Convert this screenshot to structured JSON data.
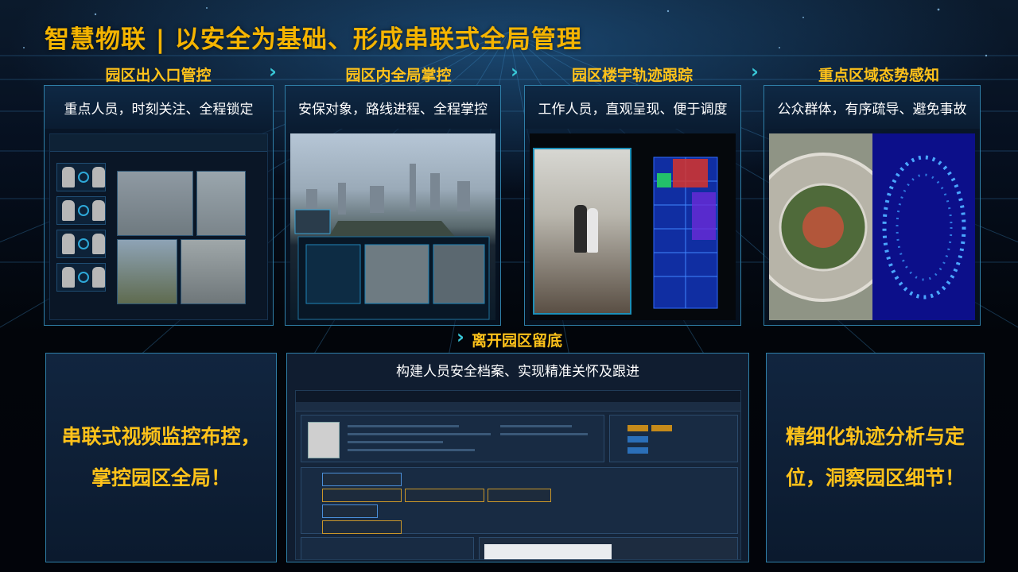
{
  "page": {
    "title": "智慧物联 | 以安全为基础、形成串联式全局管理"
  },
  "columns": [
    {
      "heading": "园区出入口管控",
      "subtitle": "重点人员，时刻关注、全程锁定"
    },
    {
      "heading": "园区内全局掌控",
      "subtitle": "安保对象，路线进程、全程掌控"
    },
    {
      "heading": "园区楼宇轨迹跟踪",
      "subtitle": "工作人员，直观呈现、便于调度"
    },
    {
      "heading": "重点区域态势感知",
      "subtitle": "公众群体，有序疏导、避免事故"
    }
  ],
  "exit_section": {
    "heading": "离开园区留底",
    "subtitle": "构建人员安全档案、实现精准关怀及跟进"
  },
  "left_callout": {
    "line1": "串联式视频监控布控，",
    "line2": "掌控园区全局！"
  },
  "right_callout": {
    "line1": "精细化轨迹分析与定",
    "line2": "位，洞察园区细节！"
  },
  "colors": {
    "title": "#f5b400",
    "heading": "#ffc21a",
    "border": "#2f7fa8",
    "chevron": "#38c6d6"
  }
}
